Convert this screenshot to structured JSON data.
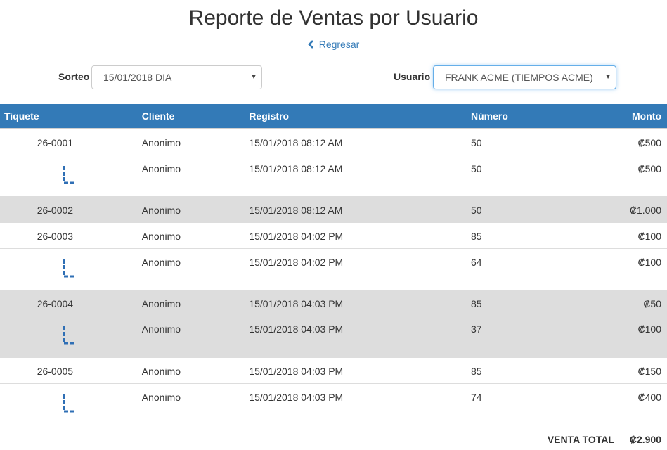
{
  "page": {
    "title": "Reporte de Ventas por Usuario",
    "back_label": "Regresar"
  },
  "filters": {
    "sorteo_label": "Sorteo",
    "sorteo_value": "15/01/2018 DIA",
    "usuario_label": "Usuario",
    "usuario_value": "FRANK ACME (TIEMPOS ACME)"
  },
  "table": {
    "headers": [
      "Tiquete",
      "Cliente",
      "Registro",
      "Número",
      "Monto"
    ],
    "rows": [
      {
        "tiquete": "26-0001",
        "cliente": "Anonimo",
        "registro": "15/01/2018 08:12 AM",
        "numero": "50",
        "monto": "₡500"
      },
      {
        "tiquete": "",
        "cliente": "Anonimo",
        "registro": "15/01/2018 08:12 AM",
        "numero": "50",
        "monto": "₡500"
      },
      {
        "tiquete": "26-0002",
        "cliente": "Anonimo",
        "registro": "15/01/2018 08:12 AM",
        "numero": "50",
        "monto": "₡1.000"
      },
      {
        "tiquete": "26-0003",
        "cliente": "Anonimo",
        "registro": "15/01/2018 04:02 PM",
        "numero": "85",
        "monto": "₡100"
      },
      {
        "tiquete": "",
        "cliente": "Anonimo",
        "registro": "15/01/2018 04:02 PM",
        "numero": "64",
        "monto": "₡100"
      },
      {
        "tiquete": "26-0004",
        "cliente": "Anonimo",
        "registro": "15/01/2018 04:03 PM",
        "numero": "85",
        "monto": "₡50"
      },
      {
        "tiquete": "",
        "cliente": "Anonimo",
        "registro": "15/01/2018 04:03 PM",
        "numero": "37",
        "monto": "₡100"
      },
      {
        "tiquete": "26-0005",
        "cliente": "Anonimo",
        "registro": "15/01/2018 04:03 PM",
        "numero": "85",
        "monto": "₡150"
      },
      {
        "tiquete": "",
        "cliente": "Anonimo",
        "registro": "15/01/2018 04:03 PM",
        "numero": "74",
        "monto": "₡400"
      }
    ]
  },
  "footer": {
    "total_label": "VENTA TOTAL",
    "total_value": "₡2.900"
  },
  "icons": {
    "back": "chevron-left-icon",
    "sub_item": "sub-item-corner-icon",
    "dropdown": "caret-down-icon"
  },
  "colors": {
    "header_bg": "#337ab7",
    "link": "#337ab7",
    "row_grey": "#dddddd",
    "focus_border": "#66afe9"
  }
}
